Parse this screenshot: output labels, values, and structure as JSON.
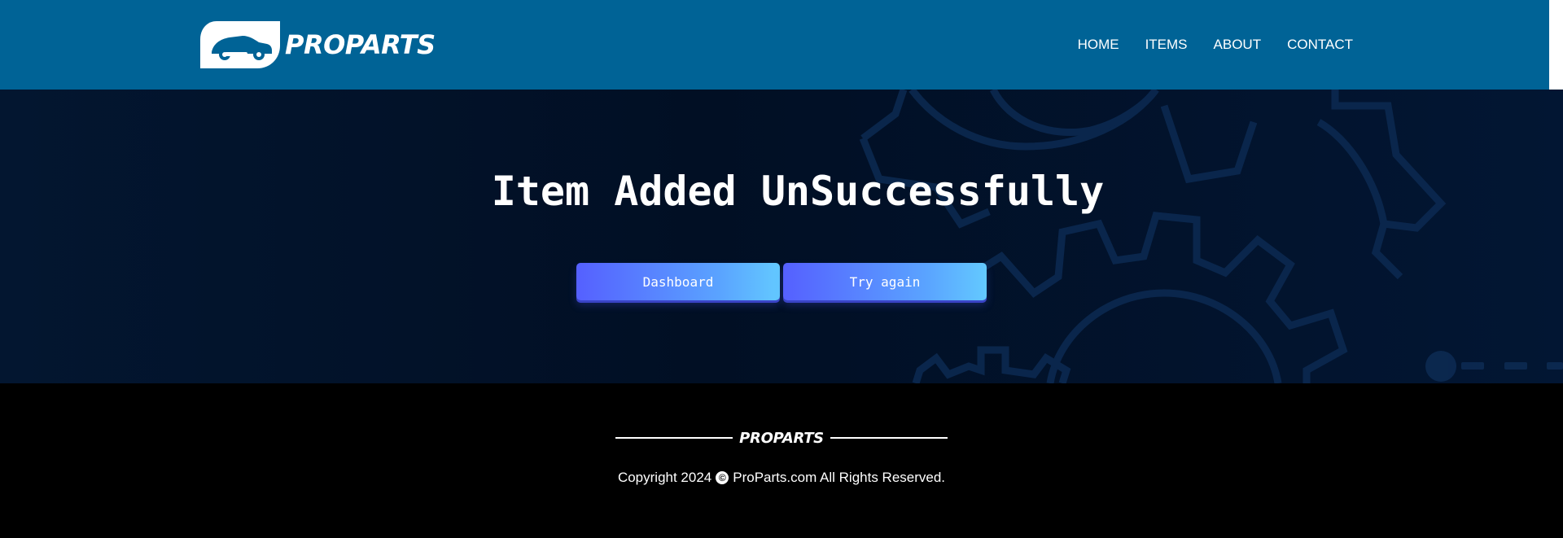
{
  "header": {
    "brand": "PROPARTS",
    "nav": [
      {
        "label": "HOME"
      },
      {
        "label": "ITEMS"
      },
      {
        "label": "ABOUT"
      },
      {
        "label": "CONTACT"
      }
    ]
  },
  "hero": {
    "title": "Item Added UnSuccessfully",
    "buttons": {
      "dashboard": "Dashboard",
      "try_again": "Try again"
    }
  },
  "footer": {
    "brand": "PROPARTS",
    "copyright_prefix": "Copyright 2024",
    "copyright_suffix": "ProParts.com All Rights Reserved.",
    "copyright_icon": "copyright-icon"
  },
  "colors": {
    "header_bg": "#006396",
    "hero_bg": "#010f24",
    "footer_bg": "#000000",
    "button_start": "#5560ff",
    "button_end": "#63c9ff"
  }
}
